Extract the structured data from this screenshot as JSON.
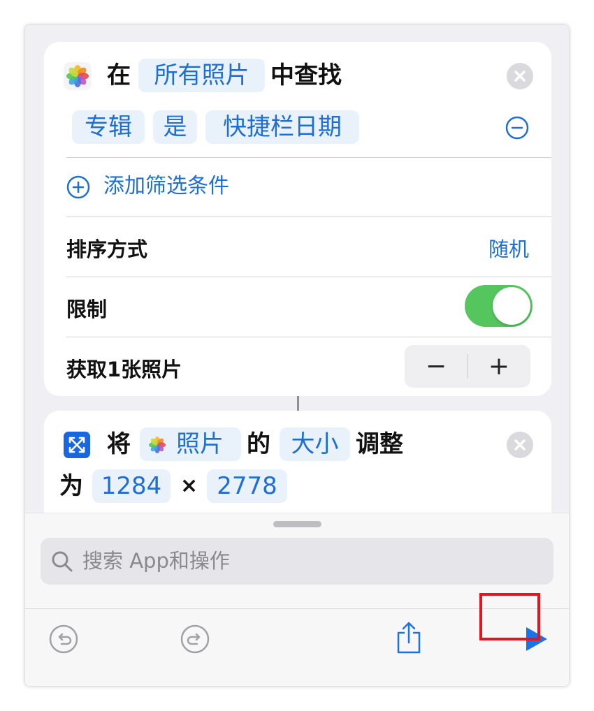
{
  "find_action": {
    "prefix": "在",
    "source": "所有照片",
    "suffix": "中查找",
    "filter": {
      "field": "专辑",
      "operator": "是",
      "value": "快捷栏日期"
    },
    "add_filter_label": "添加筛选条件",
    "sort": {
      "label": "排序方式",
      "value": "随机"
    },
    "limit": {
      "label": "限制",
      "enabled": true
    },
    "count_label": "获取1张照片",
    "stepper": {
      "minus": "−",
      "plus": "+"
    }
  },
  "resize_action": {
    "verb": "将",
    "input": "照片",
    "connector": "的",
    "property": "大小",
    "action": "调整",
    "to": "为",
    "width": "1284",
    "times": "×",
    "height": "2778"
  },
  "search": {
    "placeholder": "搜索 App和操作"
  },
  "toolbar": {
    "undo": "undo-icon",
    "redo": "redo-icon",
    "share": "share-icon",
    "run": "play-icon"
  },
  "colors": {
    "accent": "#1e6fd4",
    "token_bg": "#e9f1fb",
    "toggle_on": "#55c65e",
    "highlight": "#e4161d",
    "run": "#1a73e8"
  }
}
